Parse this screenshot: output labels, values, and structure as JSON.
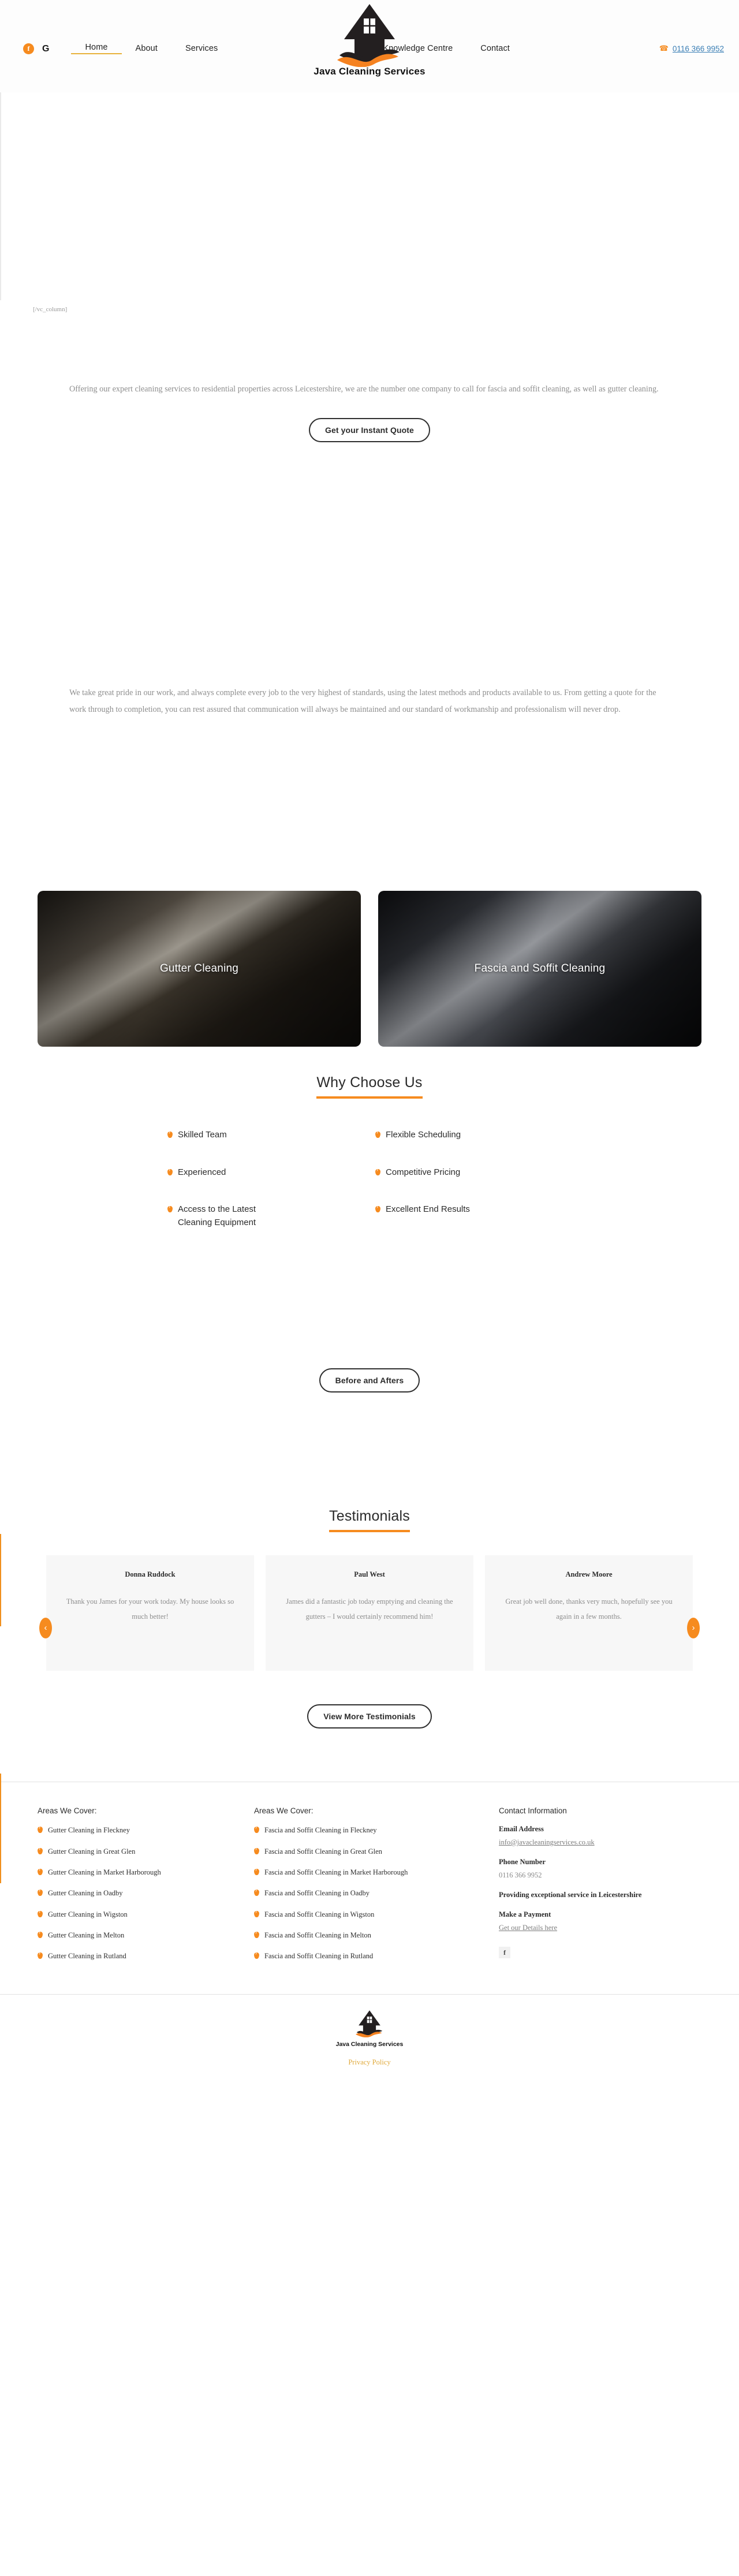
{
  "header": {
    "social": [
      {
        "name": "facebook-icon",
        "glyph": "f"
      },
      {
        "name": "google-icon",
        "glyph": "G"
      }
    ],
    "nav_left": [
      {
        "label": "Home",
        "active": true
      },
      {
        "label": "About",
        "active": false
      },
      {
        "label": "Services",
        "active": false
      }
    ],
    "nav_right": [
      {
        "label": "Knowledge Centre",
        "active": false
      },
      {
        "label": "Contact",
        "active": false
      }
    ],
    "phone": "0116 366 9952",
    "phone_icon": "phone-icon",
    "logo_text": "Java Cleaning Services",
    "accent_color": "#f68b1f",
    "rule_color": "#d79b2b"
  },
  "main": {
    "shortcode_leftover": "[/vc_column]",
    "intro_paragraph": "Offering our expert cleaning services to residential properties across Leicestershire, we are the number one company to call for fascia and soffit cleaning, as well as gutter cleaning.",
    "quote_button": "Get your Instant Quote",
    "pride_paragraph": "We take great pride in our work, and always complete every job to the very highest of standards, using the latest methods and products available to us. From getting a quote for the work through to completion, you can rest assured that communication will always be maintained and our standard of workmanship and professionalism will never drop.",
    "services": [
      {
        "label": "Gutter Cleaning"
      },
      {
        "label": "Fascia and Soffit Cleaning"
      }
    ],
    "why_choose_heading": "Why Choose Us",
    "why_choose_items": [
      "Skilled Team",
      "Flexible Scheduling",
      "Experienced",
      "Competitive Pricing",
      "Access to the Latest Cleaning Equipment",
      "Excellent End Results"
    ],
    "before_after_button": "Before and Afters",
    "testimonials_heading": "Testimonials",
    "testimonials": [
      {
        "name": "Donna Ruddock",
        "quote": "Thank you James for your work today. My house looks so much better!"
      },
      {
        "name": "Paul West",
        "quote": "James did a fantastic job today emptying and cleaning the gutters – I would certainly recommend him!"
      },
      {
        "name": "Andrew Moore",
        "quote": "Great job well done, thanks very much, hopefully see you again in a few months."
      }
    ],
    "carousel": {
      "prev": "‹",
      "next": "›"
    },
    "view_more_button": "View More Testimonials"
  },
  "footer": {
    "col1": {
      "title": "Areas We Cover:",
      "items": [
        "Gutter Cleaning in Fleckney",
        "Gutter Cleaning in Great Glen",
        "Gutter Cleaning in Market Harborough",
        "Gutter Cleaning in Oadby",
        "Gutter Cleaning in Wigston",
        "Gutter Cleaning in Melton",
        "Gutter Cleaning in Rutland"
      ]
    },
    "col2": {
      "title": "Areas We Cover:",
      "items": [
        "Fascia and Soffit Cleaning in Fleckney",
        "Fascia and Soffit Cleaning in Great Glen",
        "Fascia and Soffit Cleaning in Market Harborough",
        "Fascia and Soffit Cleaning in Oadby",
        "Fascia and Soffit Cleaning in Wigston",
        "Fascia and Soffit Cleaning in Melton",
        "Fascia and Soffit Cleaning in Rutland"
      ]
    },
    "col3": {
      "title": "Contact Information",
      "email_label": "Email Address",
      "email_value": "info@javacleaningservices.co.uk",
      "phone_label": "Phone Number",
      "phone_value": "0116 366 9952",
      "tagline": "Providing exceptional service in Leicestershire",
      "payment_label": "Make a Payment",
      "payment_link": "Get our Details here",
      "facebook_glyph": "f"
    },
    "bottom": {
      "logo_text": "Java Cleaning Services",
      "privacy": "Privacy Policy"
    }
  }
}
